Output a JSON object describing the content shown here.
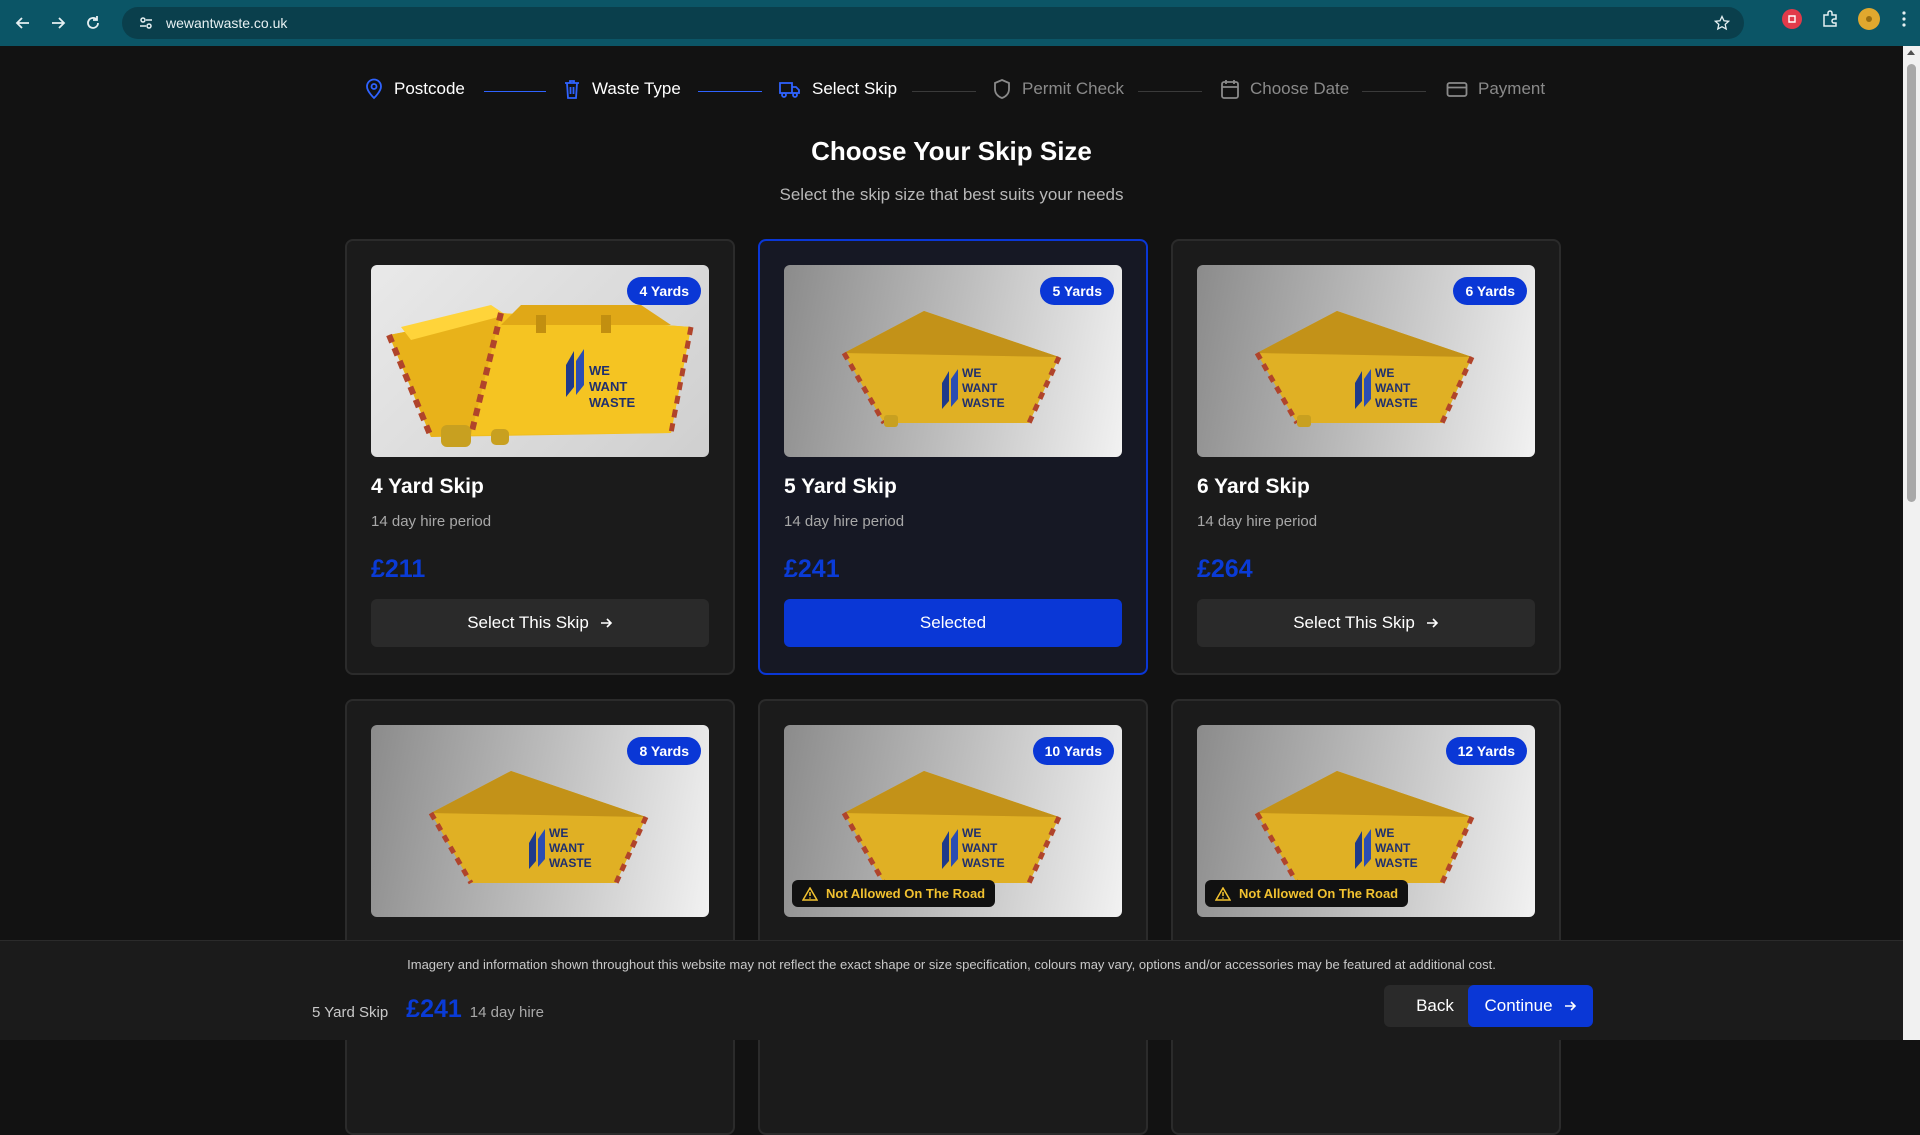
{
  "browser": {
    "url": "wewantwaste.co.uk"
  },
  "steps": [
    {
      "label": "Postcode",
      "status": "done",
      "icon": "map-pin-icon"
    },
    {
      "label": "Waste Type",
      "status": "done",
      "icon": "trash-icon"
    },
    {
      "label": "Select Skip",
      "status": "current",
      "icon": "truck-icon"
    },
    {
      "label": "Permit Check",
      "status": "todo",
      "icon": "shield-icon"
    },
    {
      "label": "Choose Date",
      "status": "todo",
      "icon": "calendar-icon"
    },
    {
      "label": "Payment",
      "status": "todo",
      "icon": "credit-card-icon"
    }
  ],
  "heading": "Choose Your Skip Size",
  "subheading": "Select the skip size that best suits your needs",
  "skips": [
    {
      "badge": "4 Yards",
      "title": "4 Yard Skip",
      "period": "14 day hire period",
      "price": "£211",
      "button": "Select This Skip",
      "selected": false,
      "warning": ""
    },
    {
      "badge": "5 Yards",
      "title": "5 Yard Skip",
      "period": "14 day hire period",
      "price": "£241",
      "button": "Selected",
      "selected": true,
      "warning": ""
    },
    {
      "badge": "6 Yards",
      "title": "6 Yard Skip",
      "period": "14 day hire period",
      "price": "£264",
      "button": "Select This Skip",
      "selected": false,
      "warning": ""
    },
    {
      "badge": "8 Yards",
      "selected": false,
      "warning": ""
    },
    {
      "badge": "10 Yards",
      "selected": false,
      "warning": "Not Allowed On The Road"
    },
    {
      "badge": "12 Yards",
      "selected": false,
      "warning": "Not Allowed On The Road"
    }
  ],
  "footer": {
    "note": "Imagery and information shown throughout this website may not reflect the exact shape or size specification, colours may vary, options and/or accessories may be featured at additional cost.",
    "selected_name": "5 Yard Skip",
    "selected_price": "£241",
    "selected_hire": "14 day hire",
    "back_label": "Back",
    "continue_label": "Continue"
  },
  "colors": {
    "accent": "#0a37d6",
    "background": "#121212",
    "card": "#1b1b1b",
    "warning": "#f2c230"
  }
}
